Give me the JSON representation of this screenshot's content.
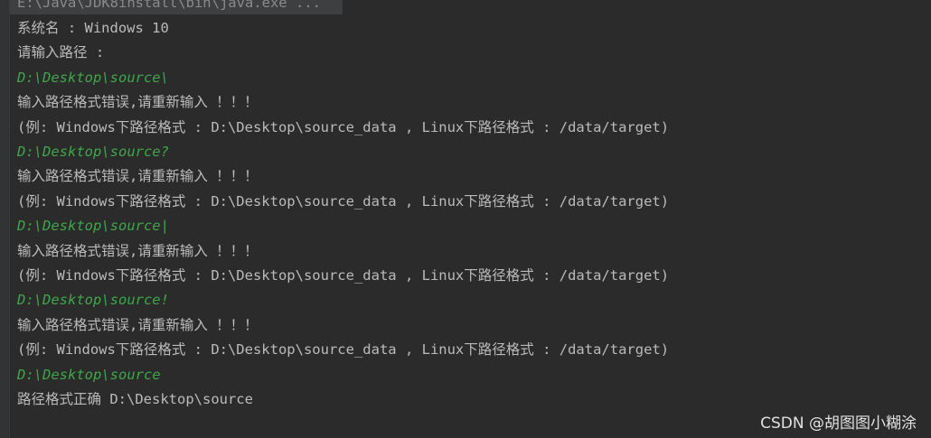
{
  "console": {
    "command_line": "E:\\Java\\JDK8install\\bin\\java.exe ...",
    "lines": [
      {
        "text": "系统名 : Windows 10",
        "kind": "output"
      },
      {
        "text": "请输入路径 :",
        "kind": "output"
      },
      {
        "text": "D:\\Desktop\\source\\",
        "kind": "input"
      },
      {
        "text": "输入路径格式错误,请重新输入 ！！！",
        "kind": "output"
      },
      {
        "text": "(例: Windows下路径格式 : D:\\Desktop\\source_data , Linux下路径格式 : /data/target)",
        "kind": "output"
      },
      {
        "text": "D:\\Desktop\\source?",
        "kind": "input"
      },
      {
        "text": "输入路径格式错误,请重新输入 ！！！",
        "kind": "output"
      },
      {
        "text": "(例: Windows下路径格式 : D:\\Desktop\\source_data , Linux下路径格式 : /data/target)",
        "kind": "output"
      },
      {
        "text": "D:\\Desktop\\source|",
        "kind": "input"
      },
      {
        "text": "输入路径格式错误,请重新输入 ！！！",
        "kind": "output"
      },
      {
        "text": "(例: Windows下路径格式 : D:\\Desktop\\source_data , Linux下路径格式 : /data/target)",
        "kind": "output"
      },
      {
        "text": "D:\\Desktop\\source!",
        "kind": "input"
      },
      {
        "text": "输入路径格式错误,请重新输入 ！！！",
        "kind": "output"
      },
      {
        "text": "(例: Windows下路径格式 : D:\\Desktop\\source_data , Linux下路径格式 : /data/target)",
        "kind": "output"
      },
      {
        "text": "D:\\Desktop\\source",
        "kind": "input"
      },
      {
        "text": "路径格式正确 D:\\Desktop\\source",
        "kind": "output"
      }
    ]
  },
  "watermark": "CSDN @胡图图小糊涂",
  "colors": {
    "background": "#2b2b2b",
    "output_text": "#bbbbbb",
    "user_input_text": "#3fa64a",
    "command_text": "#8a8a8a"
  }
}
